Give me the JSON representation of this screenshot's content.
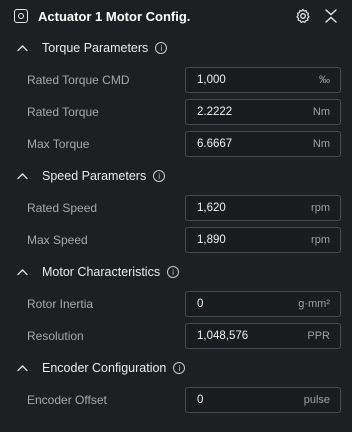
{
  "header": {
    "title": "Actuator 1 Motor Config."
  },
  "sections": [
    {
      "title": "Torque Parameters",
      "rows": [
        {
          "label": "Rated Torque CMD",
          "value": "1,000",
          "unit": "‰"
        },
        {
          "label": "Rated Torque",
          "value": "2.2222",
          "unit": "Nm"
        },
        {
          "label": "Max Torque",
          "value": "6.6667",
          "unit": "Nm"
        }
      ]
    },
    {
      "title": "Speed Parameters",
      "rows": [
        {
          "label": "Rated Speed",
          "value": "1,620",
          "unit": "rpm"
        },
        {
          "label": "Max Speed",
          "value": "1,890",
          "unit": "rpm"
        }
      ]
    },
    {
      "title": "Motor Characteristics",
      "rows": [
        {
          "label": "Rotor Inertia",
          "value": "0",
          "unit": "g·mm²"
        },
        {
          "label": "Resolution",
          "value": "1,048,576",
          "unit": "PPR"
        }
      ]
    },
    {
      "title": "Encoder Configuration",
      "rows": [
        {
          "label": "Encoder Offset",
          "value": "0",
          "unit": "pulse"
        }
      ]
    }
  ],
  "icons": {
    "info": "i"
  }
}
